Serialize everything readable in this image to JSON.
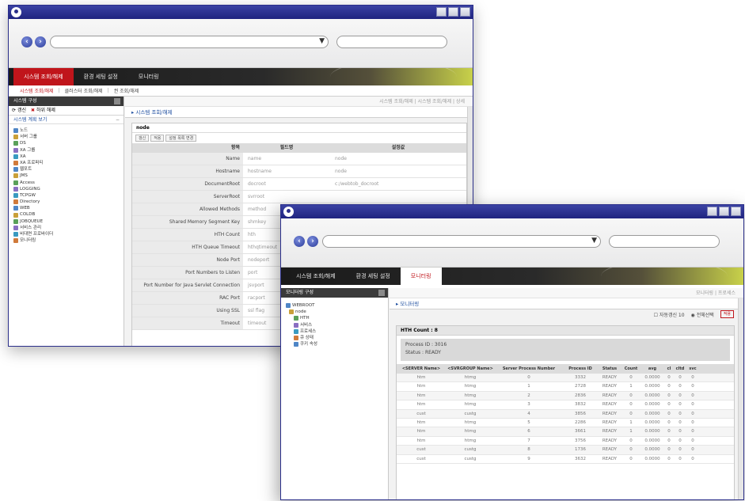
{
  "window1": {
    "menu": [
      "시스템 조회/해제",
      "환경 세팅 설정",
      "모니터링"
    ],
    "submenu": [
      "시스템 조회/해제",
      "클러스터 조회/해제",
      "권 조회/해제"
    ],
    "sidebar": {
      "header": "시스템 구성",
      "tools": [
        "갱신",
        "하위 해제"
      ],
      "subheader": "시스템 계획 보기",
      "tree": [
        "노드",
        "서버 그룹",
        "DS",
        "XA 그룹",
        "XA",
        "XA 프로퍼티",
        "웹포트",
        "JMS",
        "Access",
        "LOGGING",
        "TCPGW",
        "Directory",
        "WEB",
        "COLDB",
        "JOBQUEUE",
        "서비스 관리",
        "비대면 프로바이더",
        "모니터링"
      ]
    },
    "breadcrumb": "시스템 조회/해제 | 시스템 조회/해제 | 상세",
    "page_title": "시스템 조회/해제",
    "panel_title": "node",
    "buttons": [
      "갱신",
      "적용",
      "설정 목록 변경"
    ],
    "columns": [
      "항목",
      "필드명",
      "설정값"
    ],
    "rows": [
      {
        "label": "Name",
        "field": "name",
        "value": "node"
      },
      {
        "label": "Hostname",
        "field": "hostname",
        "value": "node"
      },
      {
        "label": "DocumentRoot",
        "field": "docroot",
        "value": "c:/webtob_docroot"
      },
      {
        "label": "ServerRoot",
        "field": "svrroot",
        "value": ""
      },
      {
        "label": "Allowed Methods",
        "field": "method",
        "value": ""
      },
      {
        "label": "Shared Memory Segment Key",
        "field": "shmkey",
        "value": ""
      },
      {
        "label": "HTH Count",
        "field": "hth",
        "value": ""
      },
      {
        "label": "HTH Queue Timeout",
        "field": "hthqtimeout",
        "value": ""
      },
      {
        "label": "Node Port",
        "field": "nodeport",
        "value": ""
      },
      {
        "label": "Port Numbers to Listen",
        "field": "port",
        "value": ""
      },
      {
        "label": "Port Number for Java Servlet Connection",
        "field": "jsvport",
        "value": ""
      },
      {
        "label": "RAC Port",
        "field": "racport",
        "value": ""
      },
      {
        "label": "Using SSL",
        "field": "ssl flag",
        "value": ""
      },
      {
        "label": "Timeout",
        "field": "timeout",
        "value": ""
      }
    ]
  },
  "window2": {
    "menu": [
      "시스템 조회/해제",
      "환경 세팅 설정",
      "모니터링"
    ],
    "sidebar": {
      "header": "모니터링 구성",
      "tree": [
        "WEBROOT",
        "node",
        "HTH",
        "서비스",
        "프로세스",
        "큐 상태",
        "쿠키 속성"
      ]
    },
    "breadcrumb": "모니터링 | 프로세스",
    "page_title": "모니터링",
    "refresh_label": "자동갱신 10",
    "check_label": "전체선택",
    "apply_label": "적용",
    "panel_title": "HTH Count : 8",
    "info": [
      "Process ID : 3016",
      "Status : READY"
    ],
    "columns": [
      "<SERVER Name>",
      "<SVRGROUP Name>",
      "Server Process Number",
      "Process ID",
      "Status",
      "Count",
      "avg",
      "cl",
      "cltd",
      "svc"
    ],
    "rows": [
      [
        "htm",
        "htmg",
        "0",
        "3332",
        "READY",
        "0",
        "0.0000",
        "0",
        "0",
        "0"
      ],
      [
        "htm",
        "htmg",
        "1",
        "2728",
        "READY",
        "1",
        "0.0000",
        "0",
        "0",
        "0"
      ],
      [
        "htm",
        "htmg",
        "2",
        "2836",
        "READY",
        "0",
        "0.0000",
        "0",
        "0",
        "0"
      ],
      [
        "htm",
        "htmg",
        "3",
        "3832",
        "READY",
        "0",
        "0.0000",
        "0",
        "0",
        "0"
      ],
      [
        "cust",
        "custg",
        "4",
        "3856",
        "READY",
        "0",
        "0.0000",
        "0",
        "0",
        "0"
      ],
      [
        "htm",
        "htmg",
        "5",
        "2286",
        "READY",
        "1",
        "0.0000",
        "0",
        "0",
        "0"
      ],
      [
        "htm",
        "htmg",
        "6",
        "3661",
        "READY",
        "1",
        "0.0000",
        "0",
        "0",
        "0"
      ],
      [
        "htm",
        "htmg",
        "7",
        "3756",
        "READY",
        "0",
        "0.0000",
        "0",
        "0",
        "0"
      ],
      [
        "cust",
        "custg",
        "8",
        "1736",
        "READY",
        "0",
        "0.0000",
        "0",
        "0",
        "0"
      ],
      [
        "cust",
        "custg",
        "9",
        "3632",
        "READY",
        "0",
        "0.0000",
        "0",
        "0",
        "0"
      ]
    ]
  },
  "colors": {
    "title_bar": "#2b2f8a",
    "menu_active": "#c0151b",
    "link": "#1f4fa0"
  }
}
